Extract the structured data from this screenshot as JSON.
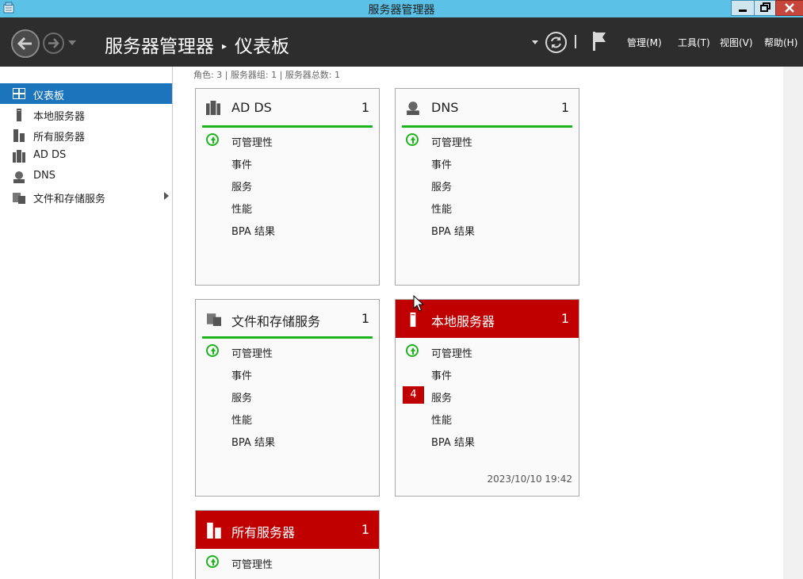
{
  "window": {
    "title": "服务器管理器",
    "accent": "#5bc1e6"
  },
  "header": {
    "breadcrumb_root": "服务器管理器",
    "breadcrumb_sep": "▸",
    "breadcrumb_current": "仪表板",
    "menus": [
      "管理(M)",
      "工具(T)",
      "视图(V)",
      "帮助(H)"
    ],
    "icons": [
      "back-icon",
      "forward-icon",
      "dropdown-icon",
      "refresh-icon",
      "flag-icon"
    ]
  },
  "sidebar": {
    "items": [
      {
        "label": "仪表板",
        "icon": "dashboard-icon",
        "selected": true
      },
      {
        "label": "本地服务器",
        "icon": "server-icon"
      },
      {
        "label": "所有服务器",
        "icon": "servers-icon"
      },
      {
        "label": "AD DS",
        "icon": "adds-icon"
      },
      {
        "label": "DNS",
        "icon": "dns-icon"
      },
      {
        "label": "文件和存储服务",
        "icon": "file-storage-icon",
        "has_submenu": true
      }
    ]
  },
  "main": {
    "summary": "角色: 3 | 服务器组: 1 | 服务器总数: 1",
    "tiles": [
      {
        "title": "AD DS",
        "count": "1",
        "status": "ok",
        "rows": [
          "可管理性",
          "事件",
          "服务",
          "性能",
          "BPA 结果"
        ]
      },
      {
        "title": "DNS",
        "count": "1",
        "status": "ok",
        "rows": [
          "可管理性",
          "事件",
          "服务",
          "性能",
          "BPA 结果"
        ]
      },
      {
        "title": "文件和存储服务",
        "count": "1",
        "status": "ok",
        "rows": [
          "可管理性",
          "事件",
          "服务",
          "性能",
          "BPA 结果"
        ]
      },
      {
        "title": "本地服务器",
        "count": "1",
        "status": "alert",
        "rows": [
          "可管理性",
          "事件",
          "服务",
          "性能",
          "BPA 结果"
        ],
        "service_badge": "4",
        "timestamp": "2023/10/10 19:42"
      },
      {
        "title": "所有服务器",
        "count": "1",
        "status": "alert",
        "rows": [
          "可管理性"
        ]
      }
    ]
  },
  "colors": {
    "ok": "#1db51d",
    "alert": "#c00000",
    "selected": "#1c75bc"
  }
}
